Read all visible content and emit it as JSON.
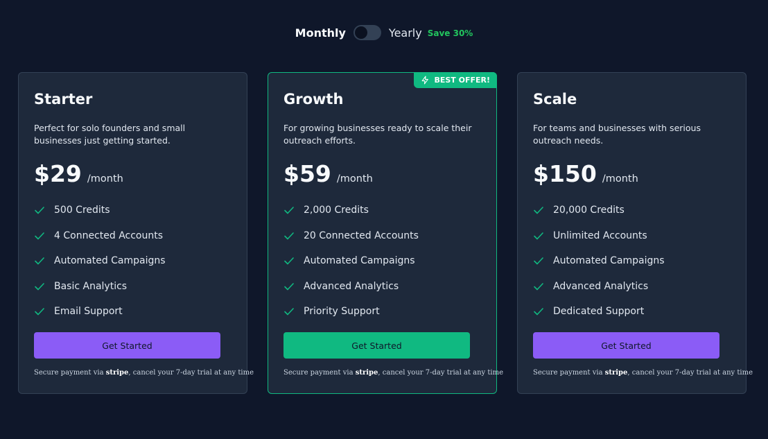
{
  "billing": {
    "monthly_label": "Monthly",
    "yearly_label": "Yearly",
    "save_label": "Save 30%",
    "selected": "Monthly"
  },
  "colors": {
    "background": "#0f172a",
    "card": "#1e293b",
    "accent_green": "#10b981",
    "accent_purple": "#8b5cf6"
  },
  "plans": [
    {
      "name": "Starter",
      "description": "Perfect for solo founders and small businesses just getting started.",
      "price": "$29",
      "period": "/month",
      "features": [
        "500 Credits",
        "4 Connected Accounts",
        "Automated Campaigns",
        "Basic Analytics",
        "Email Support"
      ],
      "cta": "Get Started",
      "secure_prefix": "Secure payment via",
      "secure_brand": "stripe",
      "secure_suffix": ", cancel your 7-day trial at any time"
    },
    {
      "name": "Growth",
      "badge": "BEST OFFER!",
      "badge_icon": "lightning-icon",
      "description": "For growing businesses ready to scale their outreach efforts.",
      "price": "$59",
      "period": "/month",
      "features": [
        "2,000 Credits",
        "20 Connected Accounts",
        "Automated Campaigns",
        "Advanced Analytics",
        "Priority Support"
      ],
      "cta": "Get Started",
      "secure_prefix": "Secure payment via",
      "secure_brand": "stripe",
      "secure_suffix": ", cancel your 7-day trial at any time"
    },
    {
      "name": "Scale",
      "description": "For teams and businesses with serious outreach needs.",
      "price": "$150",
      "period": "/month",
      "features": [
        "20,000 Credits",
        "Unlimited Accounts",
        "Automated Campaigns",
        "Advanced Analytics",
        "Dedicated Support"
      ],
      "cta": "Get Started",
      "secure_prefix": "Secure payment via",
      "secure_brand": "stripe",
      "secure_suffix": ", cancel your 7-day trial at any time"
    }
  ]
}
